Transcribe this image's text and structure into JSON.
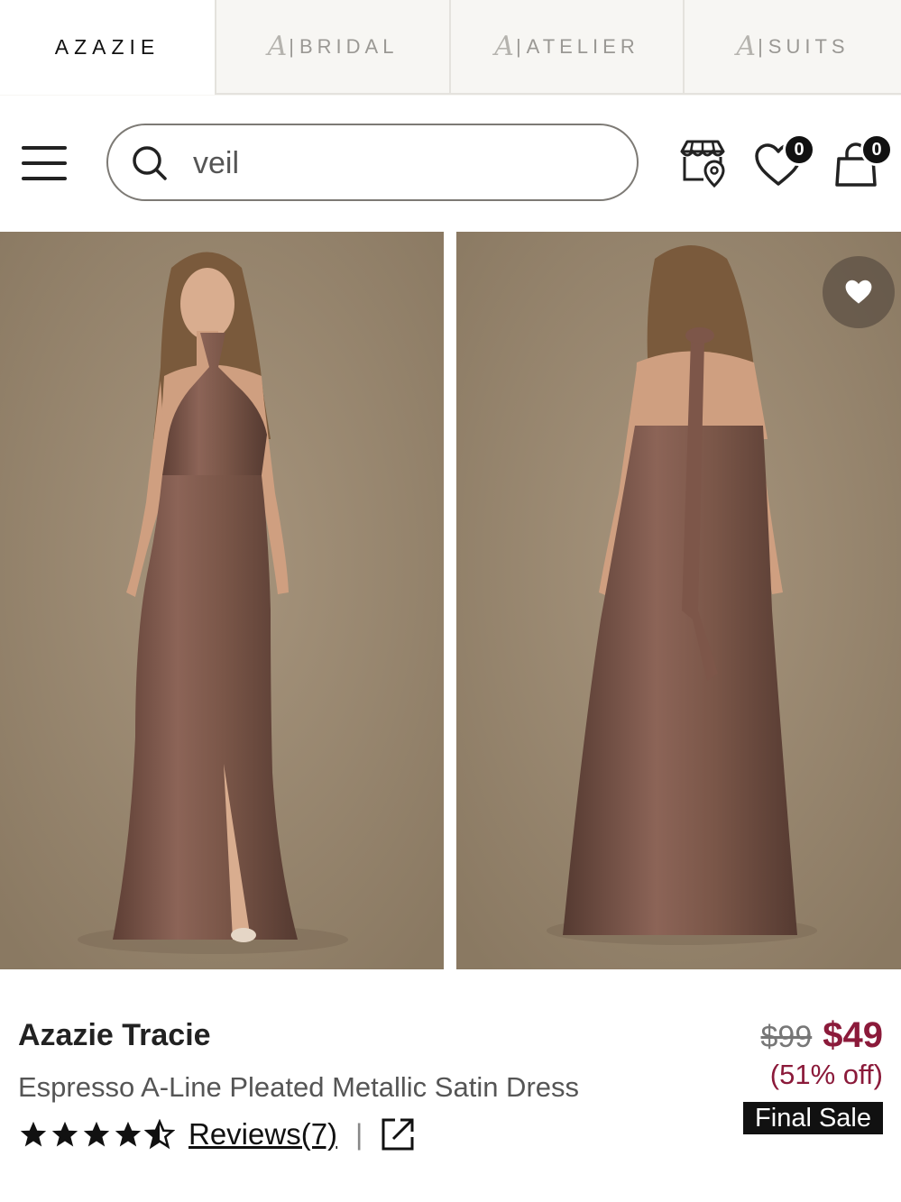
{
  "tabs": [
    {
      "label": "AZAZIE",
      "active": true
    },
    {
      "label": "BRIDAL",
      "logo": "A"
    },
    {
      "label": "ATELIER",
      "logo": "A"
    },
    {
      "label": "SUITS",
      "logo": "A"
    }
  ],
  "tab_separator": "|",
  "search": {
    "value": "veil",
    "icon": "search-icon"
  },
  "header_icons": {
    "store": "store-location-icon",
    "wishlist": {
      "icon": "heart-icon",
      "count": "0"
    },
    "cart": {
      "icon": "shopping-bag-icon",
      "count": "0"
    }
  },
  "gallery": {
    "images": [
      "front-view-photo",
      "back-view-photo"
    ],
    "favorite_icon": "heart-icon"
  },
  "product": {
    "name": "Azazie Tracie",
    "subtitle": "Espresso A-Line Pleated Metallic Satin Dress",
    "rating": 4.5,
    "reviews_label": "Reviews(7)",
    "separator": "|",
    "share_icon": "external-link-icon",
    "old_price": "$99",
    "new_price": "$49",
    "discount": "(51% off)",
    "badge": "Final Sale"
  },
  "colors": {
    "accent": "#8b1a3a",
    "dress": "#7a5648",
    "backdrop": "#9c8a72"
  }
}
